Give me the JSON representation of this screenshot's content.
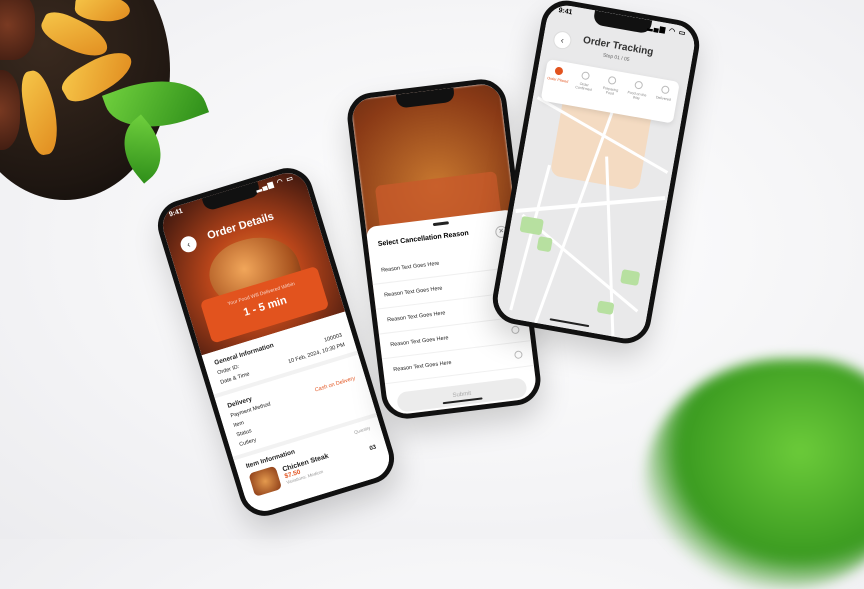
{
  "colors": {
    "accent": "#e2531e",
    "map_park": "#b7e0a0",
    "map_zone": "#f6d7b8"
  },
  "phone1": {
    "time": "9:41",
    "title": "Order Details",
    "eta_label": "Your Food Will Delivered Within",
    "eta_value": "1 - 5 min",
    "general": {
      "heading": "General Information",
      "order_id_label": "Order ID:",
      "order_id_value": "100003",
      "date_label": "Date & Time",
      "date_value": "10 Feb, 2024, 10:30 PM"
    },
    "delivery": {
      "heading": "Delivery",
      "payment_label": "Payment Method",
      "payment_value": "Cash on Delivery",
      "item_label": "Item",
      "status_label": "Status",
      "cutlery_label": "Cutlery"
    },
    "items": {
      "heading": "Item Information",
      "qty_label": "Quantity",
      "name": "Chicken Steak",
      "price": "$7.50",
      "variation": "Variations: Medium",
      "qty": "03"
    }
  },
  "phone2": {
    "title": "Select Cancellation Reason",
    "reasons": [
      "Reason Text Goes Here",
      "Reason Text Goes Here",
      "Reason Text Goes Here",
      "Reason Text Goes Here",
      "Reason Text Goes Here"
    ],
    "submit": "Submit"
  },
  "phone3": {
    "time": "9:41",
    "title": "Order Tracking",
    "subtitle": "Step 01 / 05",
    "steps": [
      "Order Placed",
      "Order Confirmed",
      "Preparing Food",
      "Food on the Way",
      "Delivered"
    ]
  }
}
